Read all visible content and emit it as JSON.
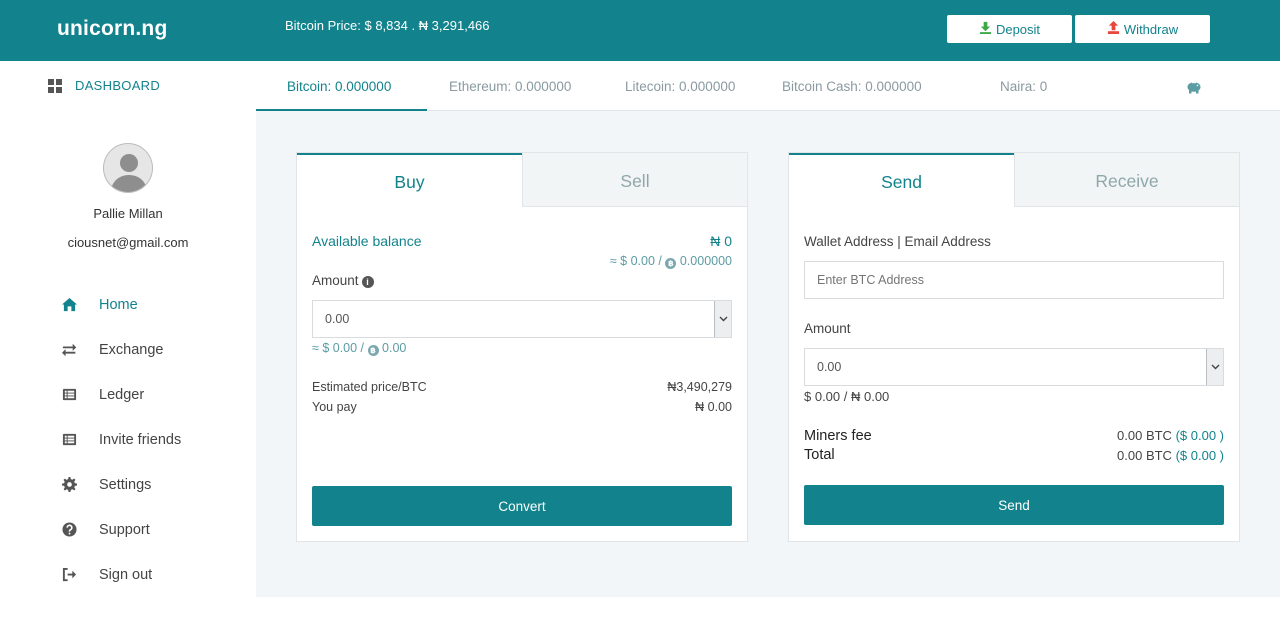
{
  "app": {
    "logo": "unicorn.ng",
    "price_text": "Bitcoin Price: $ 8,834 . ₦ 3,291,466",
    "deposit_label": "Deposit",
    "withdraw_label": "Withdraw"
  },
  "sidebar": {
    "dashboard_label": "DASHBOARD",
    "user_name": "Pallie Millan",
    "user_email": "ciousnet@gmail.com",
    "items": [
      {
        "label": "Home",
        "icon": "home-icon",
        "active": true
      },
      {
        "label": "Exchange",
        "icon": "exchange-icon",
        "active": false
      },
      {
        "label": "Ledger",
        "icon": "ledger-icon",
        "active": false
      },
      {
        "label": "Invite friends",
        "icon": "invite-icon",
        "active": false
      },
      {
        "label": "Settings",
        "icon": "gear-icon",
        "active": false
      },
      {
        "label": "Support",
        "icon": "question-icon",
        "active": false
      },
      {
        "label": "Sign out",
        "icon": "sign-out-icon",
        "active": false
      }
    ]
  },
  "balances": [
    {
      "label": "Bitcoin: 0.000000",
      "active": true
    },
    {
      "label": "Ethereum: 0.000000",
      "active": false
    },
    {
      "label": "Litecoin: 0.000000",
      "active": false
    },
    {
      "label": "Bitcoin Cash: 0.000000",
      "active": false
    },
    {
      "label": "Naira: 0",
      "active": false
    }
  ],
  "trade": {
    "tab_buy": "Buy",
    "tab_sell": "Sell",
    "available_label": "Available balance",
    "available_value": "₦ 0",
    "available_equiv_prefix": "≈ $ 0.00 /",
    "available_equiv_btc": "0.000000",
    "amount_label": "Amount",
    "amount_value": "0.00",
    "amount_equiv_prefix": "≈ $ 0.00 /",
    "amount_equiv_btc": "0.00",
    "estimated_label": "Estimated price/BTC",
    "estimated_value": "₦3,490,279",
    "you_pay_label": "You pay",
    "you_pay_value": "₦ 0.00",
    "convert_label": "Convert"
  },
  "transfer": {
    "tab_send": "Send",
    "tab_receive": "Receive",
    "address_label": "Wallet Address | Email Address",
    "address_placeholder": "Enter BTC Address",
    "amount_label": "Amount",
    "amount_value": "0.00",
    "amount_equiv": "$ 0.00 / ₦ 0.00",
    "miners_fee_label": "Miners fee",
    "miners_fee_btc": "0.00 BTC",
    "miners_fee_usd": "($ 0.00 )",
    "total_label": "Total",
    "total_btc": "0.00 BTC",
    "total_usd": "($ 0.00 )",
    "send_label": "Send"
  },
  "colors": {
    "brand": "#12838c",
    "deposit_icon": "#3aa845",
    "withdraw_icon": "#e8453c",
    "main_bg": "#f3f6f8"
  }
}
